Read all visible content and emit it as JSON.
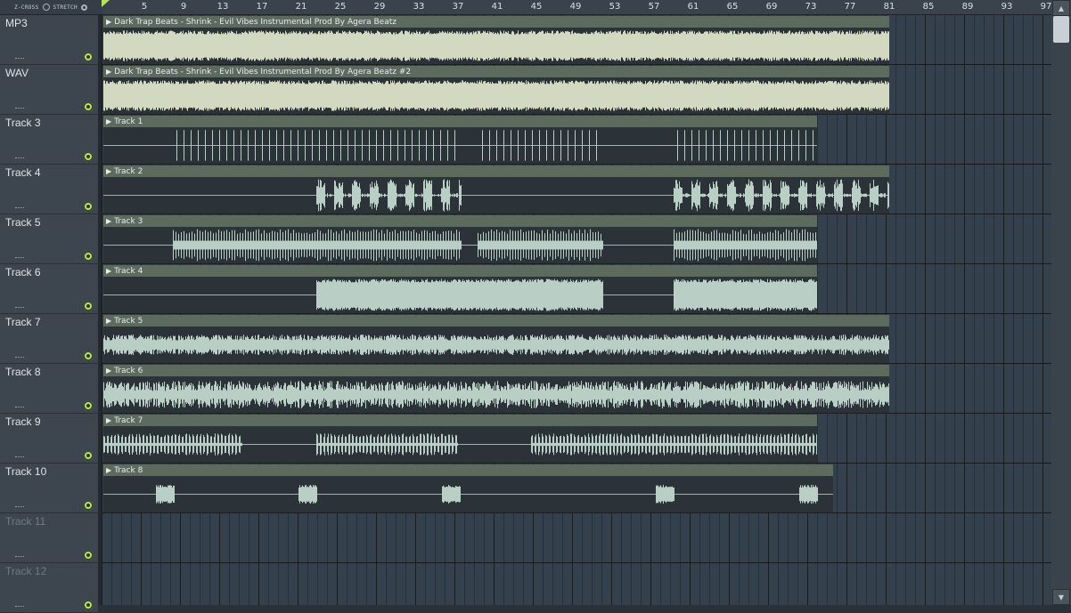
{
  "toolbar": {
    "zcross_label": "Z-CROSS",
    "stretch_label": "STRETCH"
  },
  "ruler": {
    "bars": [
      "5",
      "9",
      "13",
      "17",
      "21",
      "25",
      "29",
      "33",
      "37",
      "41",
      "45",
      "49",
      "53",
      "57",
      "61",
      "65",
      "69",
      "73",
      "77",
      "81",
      "85",
      "89",
      "93",
      "97"
    ]
  },
  "tracks": [
    {
      "name": "MP3"
    },
    {
      "name": "WAV"
    },
    {
      "name": "Track 3"
    },
    {
      "name": "Track 4"
    },
    {
      "name": "Track 5"
    },
    {
      "name": "Track 6"
    },
    {
      "name": "Track 7"
    },
    {
      "name": "Track 8"
    },
    {
      "name": "Track 9"
    },
    {
      "name": "Track 10"
    },
    {
      "name": "Track 11"
    },
    {
      "name": "Track 12"
    }
  ],
  "clips": [
    {
      "label": "Dark Trap Beats - Shrink - Evil Vibes Instrumental Prod By Agera Beatz"
    },
    {
      "label": "Dark Trap Beats - Shrink - Evil Vibes Instrumental Prod By Agera Beatz #2"
    },
    {
      "label": "Track 1"
    },
    {
      "label": "Track 2"
    },
    {
      "label": "Track 3"
    },
    {
      "label": "Track 4"
    },
    {
      "label": "Track 5"
    },
    {
      "label": "Track 6"
    },
    {
      "label": "Track 7"
    },
    {
      "label": "Track 8"
    }
  ],
  "colors": {
    "mute_led": "#b9e35a",
    "clip_title_bg": "#5d6b5f",
    "waveform_master": "#d3d9c0",
    "waveform_track": "#b9cfc6",
    "grid_bg": "#34414c"
  },
  "icons": {
    "clip_arrow": "play-arrow-icon",
    "mute": "mute-led-icon",
    "scroll_up": "chevron-up-icon",
    "scroll_down": "chevron-down-icon"
  }
}
